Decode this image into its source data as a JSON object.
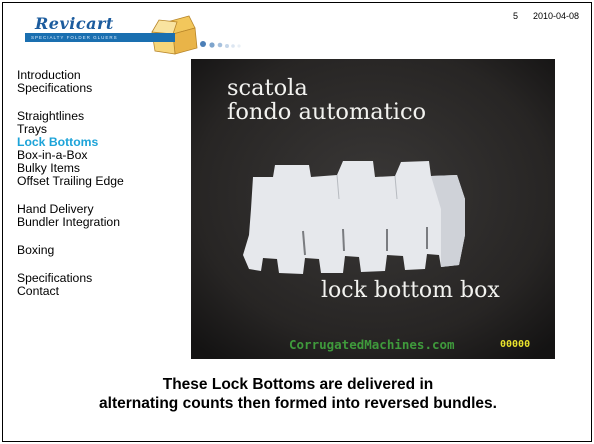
{
  "header": {
    "logo_text": "Revicart",
    "logo_tagline": "SPECIALTY FOLDER GLUERS",
    "slide_number": "5",
    "date": "2010-04-08"
  },
  "nav": {
    "groups": [
      [
        "Introduction",
        "Specifications"
      ],
      [
        "Straightlines",
        "Trays",
        "Lock Bottoms",
        "Box-in-a-Box",
        "Bulky Items",
        "Offset Trailing Edge"
      ],
      [
        "Hand Delivery",
        "Bundler Integration"
      ],
      [
        "Boxing"
      ],
      [
        "Specifications",
        "Contact"
      ]
    ],
    "active": "Lock Bottoms"
  },
  "video": {
    "caption_line1": "scatola",
    "caption_line2": "fondo automatico",
    "caption_line3": "lock bottom box",
    "watermark": "CorrugatedMachines.com",
    "counter": "00000"
  },
  "caption": {
    "line1": "These Lock Bottoms are delivered in",
    "line2": "alternating counts then formed into reversed bundles."
  },
  "colors": {
    "active_nav": "#1ca3d8",
    "logo_blue": "#1c5c9e",
    "video_bg": "#262424",
    "watermark_green": "#3f9a3c",
    "counter_yellow": "#e8e22c"
  }
}
